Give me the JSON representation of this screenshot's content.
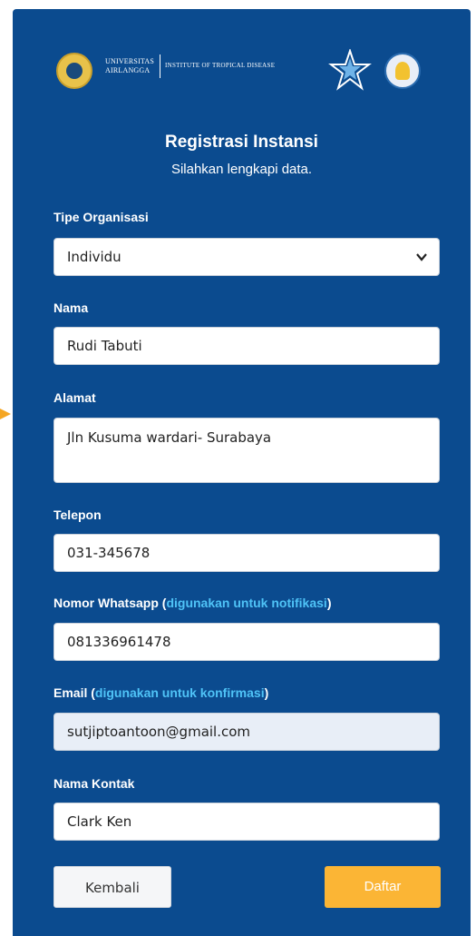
{
  "logos": {
    "ua_line1": "UNIVERSITAS",
    "ua_line2": "AIRLANGGA",
    "itd": "INSTITUTE OF TROPICAL DISEASE"
  },
  "header": {
    "title": "Registrasi Instansi",
    "subtitle": "Silahkan lengkapi data."
  },
  "form": {
    "tipe_organisasi": {
      "label": "Tipe Organisasi",
      "value": "Individu"
    },
    "nama": {
      "label": "Nama",
      "value": "Rudi Tabuti"
    },
    "alamat": {
      "label": "Alamat",
      "value": "Jln Kusuma wardari- Surabaya"
    },
    "telepon": {
      "label": "Telepon",
      "value": "031-345678"
    },
    "whatsapp": {
      "label": "Nomor Whatsapp (",
      "hint": "digunakan untuk notifikasi",
      "label_end": ")",
      "value": "081336961478"
    },
    "email": {
      "label": "Email (",
      "hint": "digunakan untuk konfirmasi",
      "label_end": ")",
      "value": "sutjiptoantoon@gmail.com"
    },
    "nama_kontak": {
      "label": "Nama Kontak",
      "value": "Clark Ken"
    }
  },
  "buttons": {
    "back": "Kembali",
    "submit": "Daftar"
  },
  "colors": {
    "panel": "#0b4b8f",
    "hint": "#4fc3f7",
    "submit": "#fbb535"
  }
}
